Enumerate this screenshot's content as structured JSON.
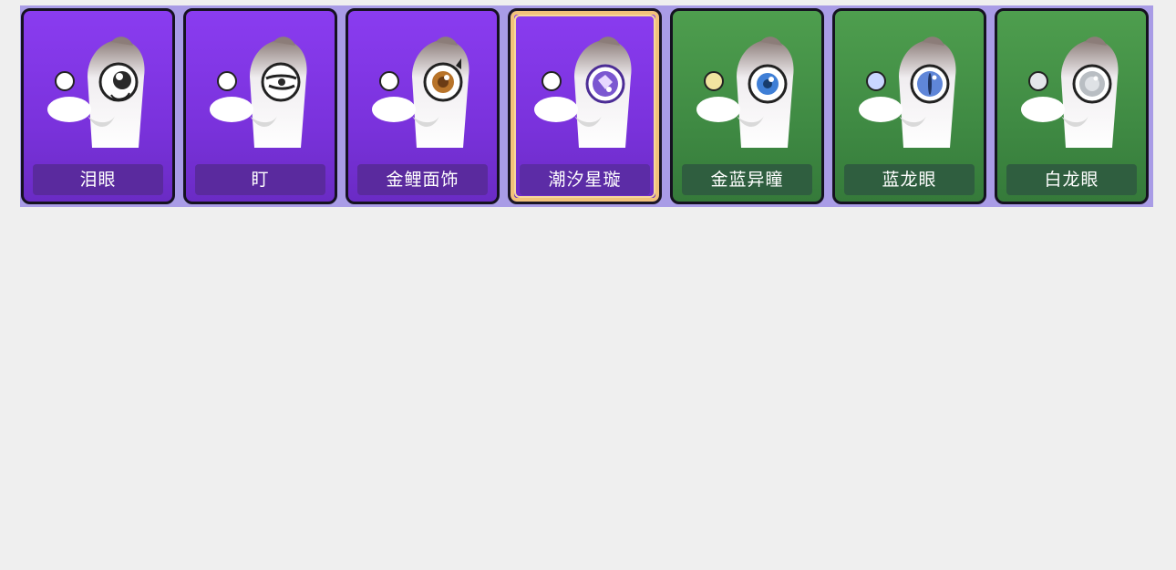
{
  "cards": [
    {
      "label": "泪眼",
      "theme": "purple",
      "iris": "#2a2a2a",
      "eye_style": "teary"
    },
    {
      "label": "盯",
      "theme": "purple",
      "iris": "#2a2a2a",
      "eye_style": "squint"
    },
    {
      "label": "金鲤面饰",
      "theme": "purple",
      "iris": "#b8742a",
      "eye_style": "golden"
    },
    {
      "label": "潮汐星璇",
      "theme": "purple",
      "iris": "#7b57d1",
      "eye_style": "starry",
      "selected": true
    },
    {
      "label": "金蓝异瞳",
      "theme": "green",
      "iris": "#3f7fd6",
      "eye_style": "heterochromia"
    },
    {
      "label": "蓝龙眼",
      "theme": "green",
      "iris": "#5f86d8",
      "eye_style": "dragon"
    },
    {
      "label": "白龙眼",
      "theme": "green",
      "iris": "#b9bec3",
      "eye_style": "white-dragon"
    }
  ],
  "colors": {
    "purple_card": "#8a3cf0",
    "green_card": "#4e9e4e",
    "selected_border": "#f2c27a",
    "background": "#efefef"
  }
}
